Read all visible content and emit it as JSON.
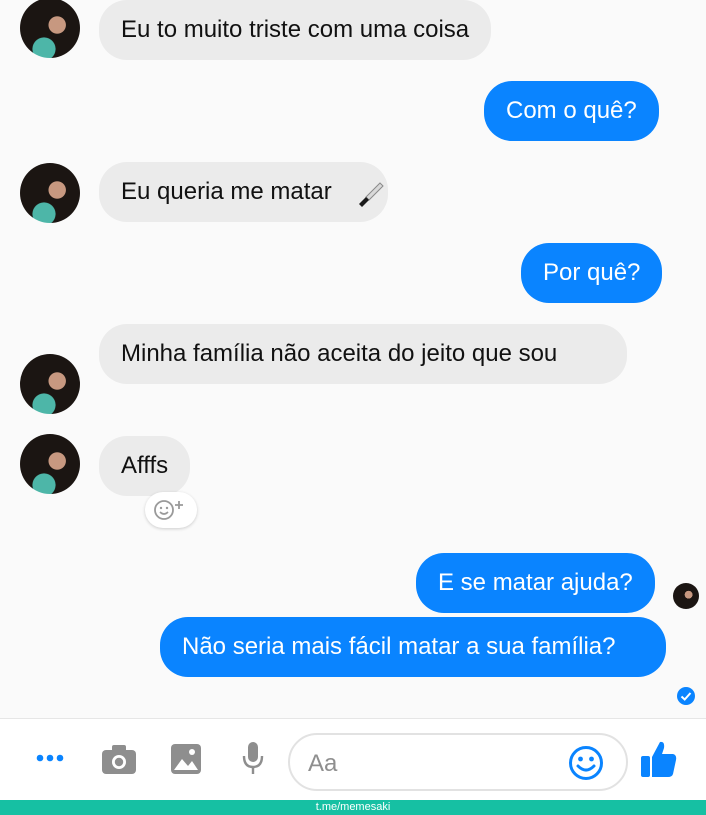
{
  "messages": [
    {
      "from": "them",
      "text": "Eu to muito triste com uma coisa"
    },
    {
      "from": "me",
      "text": "Com o quê?"
    },
    {
      "from": "them",
      "text": "Eu queria me matar",
      "emoji": "knife"
    },
    {
      "from": "me",
      "text": "Por quê?"
    },
    {
      "from": "them",
      "text": "Minha família não aceita do jeito que sou"
    },
    {
      "from": "them",
      "text": "Afffs"
    },
    {
      "from": "me",
      "text": "E se matar ajuda?"
    },
    {
      "from": "me",
      "text": "Não seria mais fácil matar a sua família?"
    }
  ],
  "composer": {
    "placeholder": "Aa",
    "icons": [
      "more-icon",
      "camera-icon",
      "gallery-icon",
      "microphone-icon",
      "emoji-icon",
      "thumbs-up-icon"
    ]
  },
  "footer": {
    "watermark": "t.me/memesaki"
  },
  "colors": {
    "outgoing": "#0a84ff",
    "incoming": "#ebebeb",
    "accent": "#0a84ff",
    "footer": "#16c0a3"
  }
}
